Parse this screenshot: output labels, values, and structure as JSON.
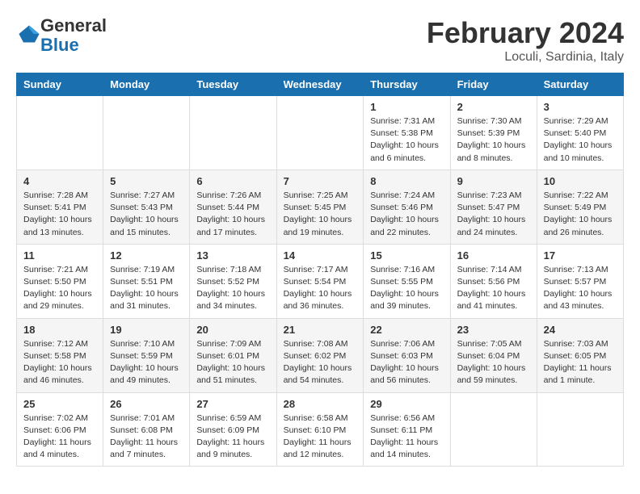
{
  "header": {
    "logo": {
      "general": "General",
      "blue": "Blue"
    },
    "title": "February 2024",
    "location": "Loculi, Sardinia, Italy"
  },
  "days_of_week": [
    "Sunday",
    "Monday",
    "Tuesday",
    "Wednesday",
    "Thursday",
    "Friday",
    "Saturday"
  ],
  "weeks": [
    [
      {
        "day": "",
        "info": ""
      },
      {
        "day": "",
        "info": ""
      },
      {
        "day": "",
        "info": ""
      },
      {
        "day": "",
        "info": ""
      },
      {
        "day": "1",
        "info": "Sunrise: 7:31 AM\nSunset: 5:38 PM\nDaylight: 10 hours\nand 6 minutes."
      },
      {
        "day": "2",
        "info": "Sunrise: 7:30 AM\nSunset: 5:39 PM\nDaylight: 10 hours\nand 8 minutes."
      },
      {
        "day": "3",
        "info": "Sunrise: 7:29 AM\nSunset: 5:40 PM\nDaylight: 10 hours\nand 10 minutes."
      }
    ],
    [
      {
        "day": "4",
        "info": "Sunrise: 7:28 AM\nSunset: 5:41 PM\nDaylight: 10 hours\nand 13 minutes."
      },
      {
        "day": "5",
        "info": "Sunrise: 7:27 AM\nSunset: 5:43 PM\nDaylight: 10 hours\nand 15 minutes."
      },
      {
        "day": "6",
        "info": "Sunrise: 7:26 AM\nSunset: 5:44 PM\nDaylight: 10 hours\nand 17 minutes."
      },
      {
        "day": "7",
        "info": "Sunrise: 7:25 AM\nSunset: 5:45 PM\nDaylight: 10 hours\nand 19 minutes."
      },
      {
        "day": "8",
        "info": "Sunrise: 7:24 AM\nSunset: 5:46 PM\nDaylight: 10 hours\nand 22 minutes."
      },
      {
        "day": "9",
        "info": "Sunrise: 7:23 AM\nSunset: 5:47 PM\nDaylight: 10 hours\nand 24 minutes."
      },
      {
        "day": "10",
        "info": "Sunrise: 7:22 AM\nSunset: 5:49 PM\nDaylight: 10 hours\nand 26 minutes."
      }
    ],
    [
      {
        "day": "11",
        "info": "Sunrise: 7:21 AM\nSunset: 5:50 PM\nDaylight: 10 hours\nand 29 minutes."
      },
      {
        "day": "12",
        "info": "Sunrise: 7:19 AM\nSunset: 5:51 PM\nDaylight: 10 hours\nand 31 minutes."
      },
      {
        "day": "13",
        "info": "Sunrise: 7:18 AM\nSunset: 5:52 PM\nDaylight: 10 hours\nand 34 minutes."
      },
      {
        "day": "14",
        "info": "Sunrise: 7:17 AM\nSunset: 5:54 PM\nDaylight: 10 hours\nand 36 minutes."
      },
      {
        "day": "15",
        "info": "Sunrise: 7:16 AM\nSunset: 5:55 PM\nDaylight: 10 hours\nand 39 minutes."
      },
      {
        "day": "16",
        "info": "Sunrise: 7:14 AM\nSunset: 5:56 PM\nDaylight: 10 hours\nand 41 minutes."
      },
      {
        "day": "17",
        "info": "Sunrise: 7:13 AM\nSunset: 5:57 PM\nDaylight: 10 hours\nand 43 minutes."
      }
    ],
    [
      {
        "day": "18",
        "info": "Sunrise: 7:12 AM\nSunset: 5:58 PM\nDaylight: 10 hours\nand 46 minutes."
      },
      {
        "day": "19",
        "info": "Sunrise: 7:10 AM\nSunset: 5:59 PM\nDaylight: 10 hours\nand 49 minutes."
      },
      {
        "day": "20",
        "info": "Sunrise: 7:09 AM\nSunset: 6:01 PM\nDaylight: 10 hours\nand 51 minutes."
      },
      {
        "day": "21",
        "info": "Sunrise: 7:08 AM\nSunset: 6:02 PM\nDaylight: 10 hours\nand 54 minutes."
      },
      {
        "day": "22",
        "info": "Sunrise: 7:06 AM\nSunset: 6:03 PM\nDaylight: 10 hours\nand 56 minutes."
      },
      {
        "day": "23",
        "info": "Sunrise: 7:05 AM\nSunset: 6:04 PM\nDaylight: 10 hours\nand 59 minutes."
      },
      {
        "day": "24",
        "info": "Sunrise: 7:03 AM\nSunset: 6:05 PM\nDaylight: 11 hours\nand 1 minute."
      }
    ],
    [
      {
        "day": "25",
        "info": "Sunrise: 7:02 AM\nSunset: 6:06 PM\nDaylight: 11 hours\nand 4 minutes."
      },
      {
        "day": "26",
        "info": "Sunrise: 7:01 AM\nSunset: 6:08 PM\nDaylight: 11 hours\nand 7 minutes."
      },
      {
        "day": "27",
        "info": "Sunrise: 6:59 AM\nSunset: 6:09 PM\nDaylight: 11 hours\nand 9 minutes."
      },
      {
        "day": "28",
        "info": "Sunrise: 6:58 AM\nSunset: 6:10 PM\nDaylight: 11 hours\nand 12 minutes."
      },
      {
        "day": "29",
        "info": "Sunrise: 6:56 AM\nSunset: 6:11 PM\nDaylight: 11 hours\nand 14 minutes."
      },
      {
        "day": "",
        "info": ""
      },
      {
        "day": "",
        "info": ""
      }
    ]
  ]
}
